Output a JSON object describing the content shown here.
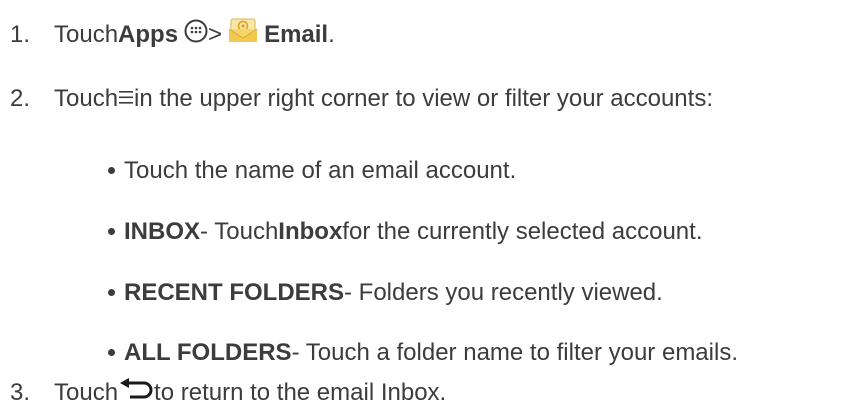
{
  "steps": [
    {
      "number": "1.",
      "prefix": "Touch ",
      "apps": "Apps",
      "sep": " > ",
      "email": "Email",
      "suffix": ".",
      "icons": [
        "apps-icon",
        "email-app-icon"
      ]
    },
    {
      "number": "2.",
      "prefix": "Touch ",
      "text": " in the upper right corner to view or filter your accounts:",
      "icon": "menu-icon"
    },
    {
      "number": "3.",
      "prefix": "Touch ",
      "text": " to return to the email Inbox.",
      "icon": "back-arrow-icon"
    }
  ],
  "bullets": [
    {
      "label": "",
      "text": "Touch the name of an email account."
    },
    {
      "label": "INBOX",
      "mid": " - Touch ",
      "bold2": "Inbox",
      "text": " for the currently selected account."
    },
    {
      "label": "RECENT FOLDERS",
      "text": " - Folders you recently viewed."
    },
    {
      "label": "ALL FOLDERS",
      "text": " - Touch a folder name to filter your emails."
    }
  ],
  "colors": {
    "text": "#3c3c3c",
    "email_icon_envelope": "#f2c94c",
    "email_icon_at": "#e0a21a"
  }
}
